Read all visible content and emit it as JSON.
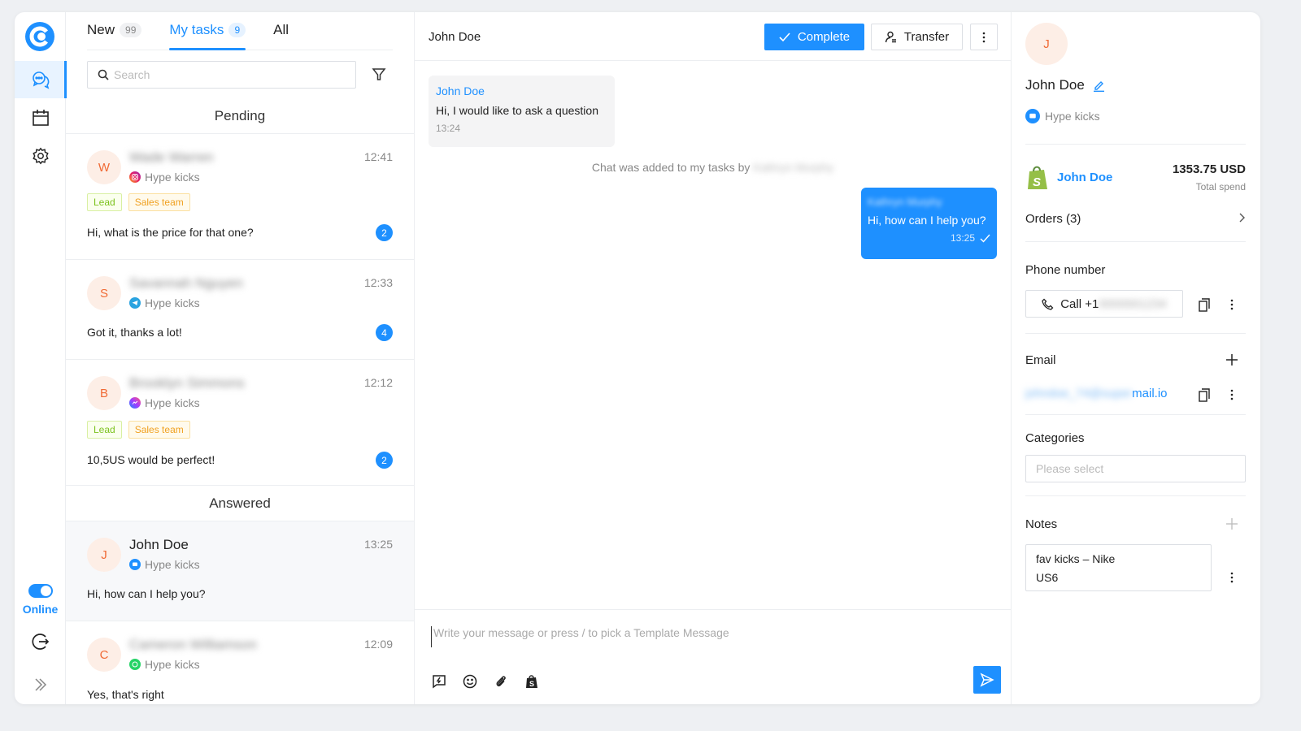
{
  "rail": {
    "items": [
      {
        "name": "chats",
        "icon": "chat-bubbles-icon",
        "active": true
      },
      {
        "name": "calendar",
        "icon": "calendar-icon",
        "active": false
      },
      {
        "name": "settings",
        "icon": "gear-icon",
        "active": false
      }
    ],
    "status_label": "Online",
    "status_on": true
  },
  "list": {
    "tabs": [
      {
        "label": "New",
        "count": "99",
        "active": false
      },
      {
        "label": "My tasks",
        "count": "9",
        "active": true
      },
      {
        "label": "All",
        "count": "",
        "active": false
      }
    ],
    "search_placeholder": "Search",
    "sections": {
      "pending": "Pending",
      "answered": "Answered"
    },
    "conversations": [
      {
        "initial": "W",
        "name": "Wade Warren",
        "name_blurred": true,
        "channel": "Hype kicks",
        "channel_type": "instagram",
        "time": "12:41",
        "tags": [
          "Lead",
          "Sales team"
        ],
        "preview": "Hi, what is the price for that one?",
        "unread": "2"
      },
      {
        "initial": "S",
        "name": "Savannah Nguyen",
        "name_blurred": true,
        "channel": "Hype kicks",
        "channel_type": "telegram",
        "time": "12:33",
        "tags": [],
        "preview": "Got it, thanks a lot!",
        "unread": "4"
      },
      {
        "initial": "B",
        "name": "Brooklyn Simmons",
        "name_blurred": true,
        "channel": "Hype kicks",
        "channel_type": "messenger",
        "time": "12:12",
        "tags": [
          "Lead",
          "Sales team"
        ],
        "preview": "10,5US would be perfect!",
        "unread": "2"
      },
      {
        "initial": "J",
        "name": "John Doe",
        "name_blurred": false,
        "channel": "Hype kicks",
        "channel_type": "livechat",
        "time": "13:25",
        "tags": [],
        "preview": "Hi, how can I help you?",
        "unread": ""
      },
      {
        "initial": "C",
        "name": "Cameron Williamson",
        "name_blurred": true,
        "channel": "Hype kicks",
        "channel_type": "whatsapp",
        "time": "12:09",
        "tags": [],
        "preview": "Yes, that's right",
        "unread": ""
      }
    ]
  },
  "chat": {
    "title": "John Doe",
    "complete_label": "Complete",
    "transfer_label": "Transfer",
    "messages": {
      "incoming": {
        "sender": "John Doe",
        "text": "Hi, I would like to ask a question",
        "time": "13:24"
      },
      "system": {
        "text": "Chat was added to my tasks by",
        "agent": "Kathryn Murphy"
      },
      "outgoing": {
        "sender": "Kathryn Murphy",
        "text": "Hi, how can I help you?",
        "time": "13:25"
      }
    },
    "composer_placeholder": "Write your message or press / to pick a Template Message"
  },
  "details": {
    "initial": "J",
    "name": "John Doe",
    "channel": "Hype kicks",
    "shopify": {
      "customer": "John Doe",
      "total": "1353.75 USD",
      "total_label": "Total spend",
      "orders": "Orders (3)"
    },
    "phone_label": "Phone number",
    "call_prefix": "Call +1",
    "call_number": "0000001234",
    "email_label": "Email",
    "email_user": "johndoe_74@super",
    "email_domain": "mail.io",
    "categories_label": "Categories",
    "categories_placeholder": "Please select",
    "notes_label": "Notes",
    "notes": [
      "fav kicks – Nike",
      "US6"
    ]
  },
  "colors": {
    "accent": "#1e90ff",
    "avatar_bg": "#fdeee6",
    "avatar_fg": "#f06a35",
    "tag_lead": "#7cc21d",
    "tag_sales": "#f0a020"
  }
}
